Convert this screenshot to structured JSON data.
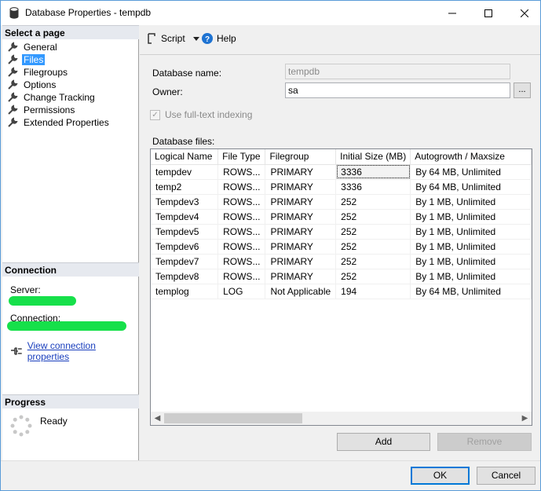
{
  "window": {
    "title": "Database Properties - tempdb"
  },
  "left": {
    "select_page_header": "Select a page",
    "pages": [
      {
        "label": "General",
        "selected": false
      },
      {
        "label": "Files",
        "selected": true
      },
      {
        "label": "Filegroups",
        "selected": false
      },
      {
        "label": "Options",
        "selected": false
      },
      {
        "label": "Change Tracking",
        "selected": false
      },
      {
        "label": "Permissions",
        "selected": false
      },
      {
        "label": "Extended Properties",
        "selected": false
      }
    ],
    "connection_header": "Connection",
    "server_label": "Server:",
    "connection_label": "Connection:",
    "view_connection_link": "View connection properties",
    "progress_header": "Progress",
    "progress_status": "Ready"
  },
  "toolbar": {
    "script_label": "Script",
    "help_label": "Help"
  },
  "form": {
    "db_name_label": "Database name:",
    "db_name_value": "tempdb",
    "owner_label": "Owner:",
    "owner_value": "sa",
    "browse_label": "...",
    "fulltext_label": "Use full-text indexing",
    "db_files_label": "Database files:"
  },
  "files_table": {
    "columns": [
      "Logical Name",
      "File Type",
      "Filegroup",
      "Initial Size (MB)",
      "Autogrowth / Maxsize"
    ],
    "rows": [
      [
        "tempdev",
        "ROWS...",
        "PRIMARY",
        "3336",
        "By 64 MB, Unlimited"
      ],
      [
        "temp2",
        "ROWS...",
        "PRIMARY",
        "3336",
        "By 64 MB, Unlimited"
      ],
      [
        "Tempdev3",
        "ROWS...",
        "PRIMARY",
        "252",
        "By 1 MB, Unlimited"
      ],
      [
        "Tempdev4",
        "ROWS...",
        "PRIMARY",
        "252",
        "By 1 MB, Unlimited"
      ],
      [
        "Tempdev5",
        "ROWS...",
        "PRIMARY",
        "252",
        "By 1 MB, Unlimited"
      ],
      [
        "Tempdev6",
        "ROWS...",
        "PRIMARY",
        "252",
        "By 1 MB, Unlimited"
      ],
      [
        "Tempdev7",
        "ROWS...",
        "PRIMARY",
        "252",
        "By 1 MB, Unlimited"
      ],
      [
        "Tempdev8",
        "ROWS...",
        "PRIMARY",
        "252",
        "By 1 MB, Unlimited"
      ],
      [
        "templog",
        "LOG",
        "Not Applicable",
        "194",
        "By 64 MB, Unlimited"
      ]
    ]
  },
  "buttons": {
    "add": "Add",
    "remove": "Remove",
    "ok": "OK",
    "cancel": "Cancel"
  },
  "colors": {
    "accent": "#0078d7",
    "selection": "#3399ff",
    "link": "#1a3fbd",
    "redaction": "#16e04a"
  }
}
